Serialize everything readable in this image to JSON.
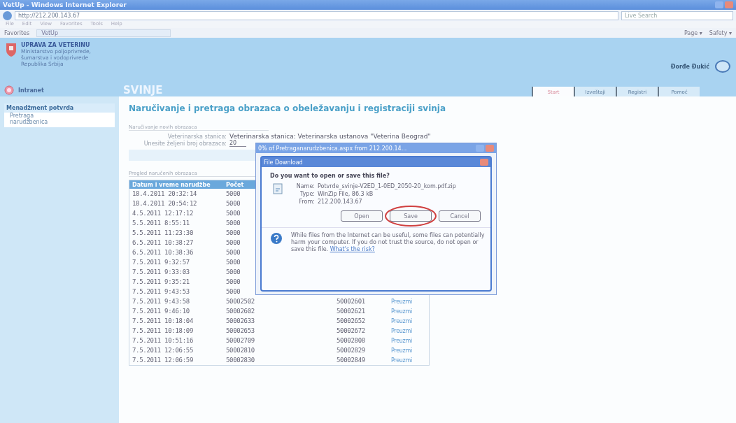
{
  "browser": {
    "title": "VetUp - Windows Internet Explorer",
    "address": "http://212.200.143.67",
    "search_placeholder": "Live Search",
    "menu": [
      "File",
      "Edit",
      "View",
      "Favorites",
      "Tools",
      "Help"
    ],
    "favorites_label": "Favorites",
    "tab_title": "VetUp",
    "commands": [
      "Page ▾",
      "Safety ▾"
    ]
  },
  "header": {
    "org_name": "UPRAVA ZA VETERINU",
    "org_lines": [
      "Ministarstvo poljoprivrede,",
      "šumarstva i vodoprivrede",
      "Republika Srbija"
    ],
    "user": "Đorđe Đukić",
    "intranet": "Intranet",
    "section": "SVINJE"
  },
  "tabs": [
    {
      "label": "Start",
      "selected": true
    },
    {
      "label": "Izveštaji",
      "selected": false
    },
    {
      "label": "Registri",
      "selected": false
    },
    {
      "label": "Pomoć",
      "selected": false
    }
  ],
  "sidebar": {
    "heading": "Menadžment potvrda",
    "items": [
      "Pretraga narudžbenica"
    ]
  },
  "main": {
    "heading": "Naručivanje i pretraga obrazaca o obeležavanju i registraciji svinja",
    "order_section": "Naručivanje novih obrazaca",
    "station_label": "Veterinarska stanica:",
    "station_value": "Veterinarska stanica: Veterinarska ustanova \"Veterina Beograd\"",
    "count_label": "Unesite željeni broj obrazaca:",
    "count_value": "20",
    "list_section": "Pregled naručenih obrazaca"
  },
  "table": {
    "columns": [
      "Datum i vreme narudžbe",
      "Počet"
    ],
    "rows": [
      {
        "date": "18.4.2011 20:32:14",
        "from": "5000"
      },
      {
        "date": "18.4.2011 20:54:12",
        "from": "5000"
      },
      {
        "date": "4.5.2011 12:17:12",
        "from": "5000"
      },
      {
        "date": "5.5.2011 8:55:11",
        "from": "5000"
      },
      {
        "date": "5.5.2011 11:23:30",
        "from": "5000"
      },
      {
        "date": "6.5.2011 10:38:27",
        "from": "5000"
      },
      {
        "date": "6.5.2011 10:38:36",
        "from": "5000"
      },
      {
        "date": "7.5.2011 9:32:57",
        "from": "5000"
      },
      {
        "date": "7.5.2011 9:33:03",
        "from": "5000"
      },
      {
        "date": "7.5.2011 9:35:21",
        "from": "5000"
      },
      {
        "date": "7.5.2011 9:43:53",
        "from": "5000"
      },
      {
        "date": "7.5.2011 9:43:58",
        "from": "50002502",
        "to": "50002601",
        "action": "Preuzmi"
      },
      {
        "date": "7.5.2011 9:46:10",
        "from": "50002602",
        "to": "50002621",
        "action": "Preuzmi"
      },
      {
        "date": "7.5.2011 10:18:04",
        "from": "50002633",
        "to": "50002652",
        "action": "Preuzmi"
      },
      {
        "date": "7.5.2011 10:18:09",
        "from": "50002653",
        "to": "50002672",
        "action": "Preuzmi"
      },
      {
        "date": "7.5.2011 10:51:16",
        "from": "50002709",
        "to": "50002808",
        "action": "Preuzmi"
      },
      {
        "date": "7.5.2011 12:06:55",
        "from": "50002810",
        "to": "50002829",
        "action": "Preuzmi"
      },
      {
        "date": "7.5.2011 12:06:59",
        "from": "50002830",
        "to": "50002849",
        "action": "Preuzmi"
      }
    ]
  },
  "dialog": {
    "window_title": "0% of Pretraganarudzbenica.aspx from 212.200.14...",
    "title": "File Download",
    "question": "Do you want to open or save this file?",
    "fields": [
      {
        "label": "Name:",
        "value": "Potvrde_svinje-V2ED_1-0ED_2050-20_kom.pdf.zip"
      },
      {
        "label": "Type:",
        "value": "WinZip File, 86.3 kB"
      },
      {
        "label": "From:",
        "value": "212.200.143.67"
      }
    ],
    "buttons": [
      "Open",
      "Save",
      "Cancel"
    ],
    "warning": "While files from the Internet can be useful, some files can potentially harm your computer. If you do not trust the source, do not open or save this file.",
    "link": "What's the risk?"
  }
}
